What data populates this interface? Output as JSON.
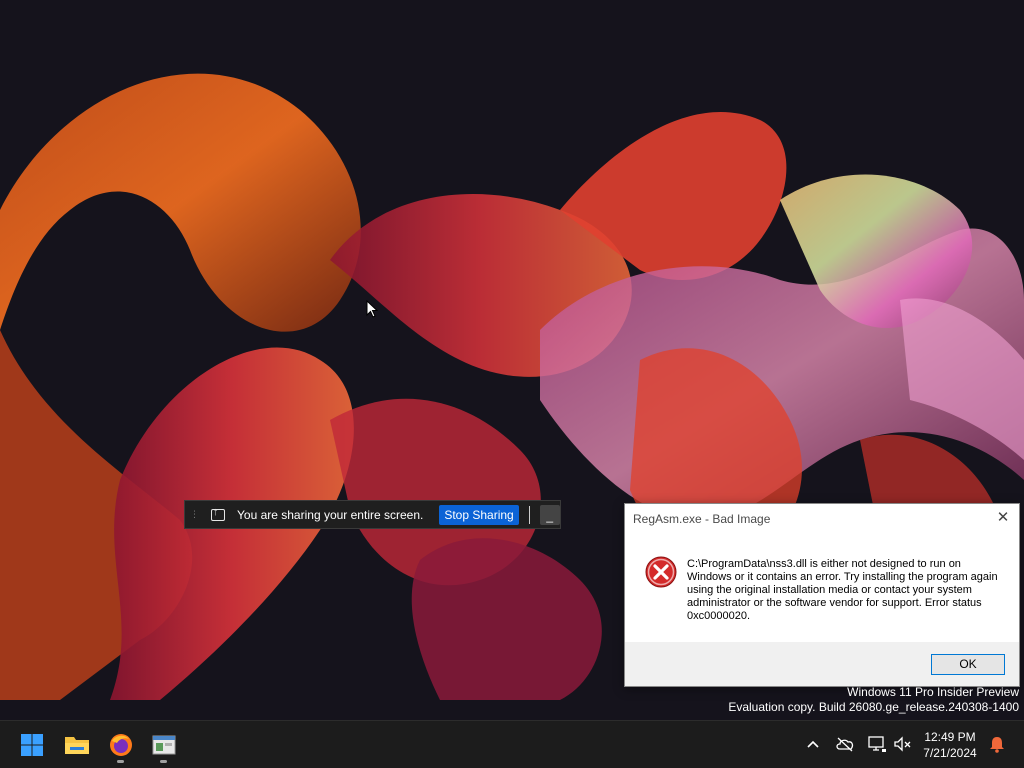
{
  "share_bar": {
    "message": "You are sharing your entire screen.",
    "stop_label": "Stop Sharing",
    "minimize_label": "_"
  },
  "dialog": {
    "title": "RegAsm.exe - Bad Image",
    "message": "C:\\ProgramData\\nss3.dll is either not designed to run on Windows or it contains an error. Try installing the program again using the original installation media or contact your system administrator or the software vendor for support. Error status 0xc0000020.",
    "ok_label": "OK",
    "close_glyph": "✕"
  },
  "watermark": {
    "line1": "Windows 11 Pro Insider Preview",
    "line2": "Evaluation copy. Build 26080.ge_release.240308-1400"
  },
  "taskbar": {
    "apps": [
      {
        "name": "start",
        "icon": "windows-logo-icon"
      },
      {
        "name": "file-explorer",
        "icon": "folder-icon"
      },
      {
        "name": "firefox",
        "icon": "firefox-icon"
      },
      {
        "name": "app-window",
        "icon": "window-app-icon"
      }
    ],
    "tray": {
      "chevron": "^",
      "icons": [
        "cloud-offline-icon",
        "display-network-icon",
        "speaker-muted-icon"
      ]
    },
    "clock": {
      "time": "12:49 PM",
      "date": "7/21/2024"
    }
  },
  "colors": {
    "accent": "#0b63d6",
    "taskbar_bg": "#1c1c1c",
    "desktop_bg": "#15131c",
    "error_red": "#d42b2b",
    "notification_bell": "#f0683a"
  }
}
